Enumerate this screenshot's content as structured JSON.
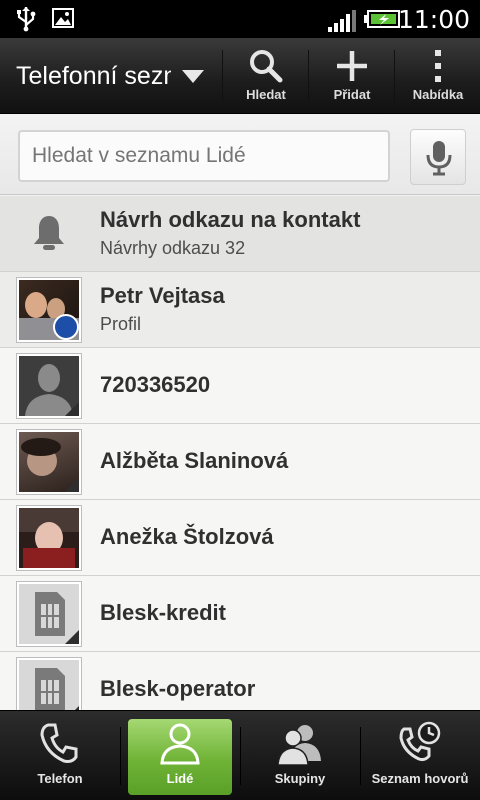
{
  "status_bar": {
    "time": "11:00",
    "icons": [
      "usb-icon",
      "image-icon",
      "signal-icon",
      "battery-charging-icon"
    ]
  },
  "action_bar": {
    "title": "Telefonní seznam",
    "buttons": [
      {
        "label": "Hledat",
        "icon": "search-icon"
      },
      {
        "label": "Přidat",
        "icon": "plus-icon"
      },
      {
        "label": "Nabídka",
        "icon": "menu-dots-icon"
      }
    ]
  },
  "search": {
    "placeholder": "Hledat v seznamu Lidé",
    "mic_icon": "microphone-icon"
  },
  "suggestion": {
    "title": "Návrh odkazu na kontakt",
    "subtitle": "Návrhy odkazu 32",
    "icon": "bell-icon"
  },
  "contacts": [
    {
      "name": "Petr Vejtasa",
      "subtitle": "Profil"
    },
    {
      "name": "720336520"
    },
    {
      "name": "Alžběta Slaninová"
    },
    {
      "name": "Anežka Štolzová"
    },
    {
      "name": "Blesk-kredit"
    },
    {
      "name": "Blesk-operator"
    }
  ],
  "tabs": [
    {
      "label": "Telefon",
      "icon": "phone-icon",
      "active": false
    },
    {
      "label": "Lidé",
      "icon": "person-icon",
      "active": true
    },
    {
      "label": "Skupiny",
      "icon": "group-icon",
      "active": false
    },
    {
      "label": "Seznam hovorů",
      "icon": "call-history-icon",
      "active": false
    }
  ],
  "colors": {
    "active_tab": "#6fb336",
    "status_bar": "#000000",
    "action_bar": "#1c1c1c",
    "battery": "#5bc236"
  }
}
